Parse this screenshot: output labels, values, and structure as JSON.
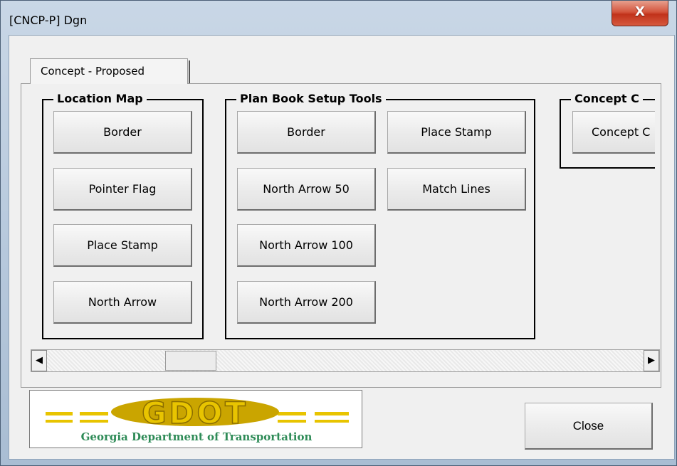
{
  "window": {
    "title": "[CNCP-P] Dgn",
    "close_glyph": "X"
  },
  "tabs": [
    {
      "label": "Concept - Proposed",
      "selected": true
    }
  ],
  "groups": {
    "location_map": {
      "label": "Location Map",
      "buttons": [
        "Border",
        "Pointer Flag",
        "Place Stamp",
        "North Arrow"
      ]
    },
    "plan_book": {
      "label": "Plan Book Setup Tools",
      "buttons_left": [
        "Border",
        "North Arrow 50",
        "North Arrow 100",
        "North Arrow 200"
      ],
      "buttons_right": [
        "Place Stamp",
        "Match Lines"
      ]
    },
    "concept_c": {
      "label": "Concept C",
      "buttons": [
        "Concept C"
      ]
    }
  },
  "scrollbar": {
    "left_arrow": "◀",
    "right_arrow": "▶"
  },
  "logo": {
    "wordmark": "GDOT",
    "caption": "Georgia Department of Transportation"
  },
  "footer": {
    "close_label": "Close"
  },
  "colors": {
    "logo_gold": "#e8c400",
    "logo_green": "#2e8b57",
    "title_close_red": "#c1321a"
  }
}
